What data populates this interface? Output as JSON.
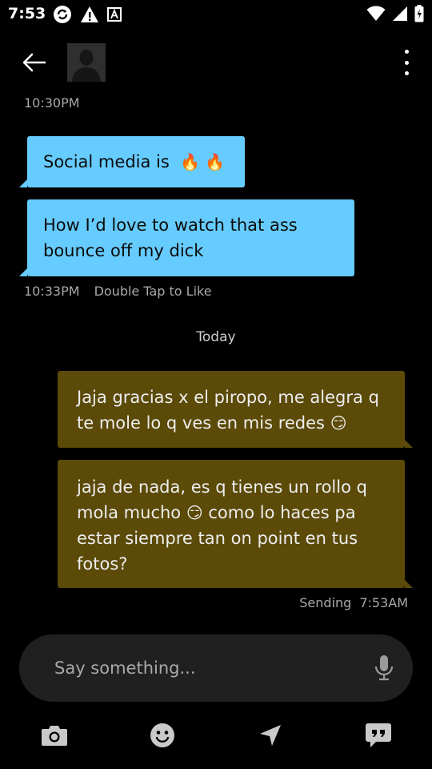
{
  "status_bar": {
    "time": "7:53"
  },
  "header": {
    "back_label": "Back",
    "menu_label": "More options"
  },
  "conversation": {
    "first_timestamp": "10:30PM",
    "incoming": [
      {
        "text": "Social media is",
        "emoji": "🔥 🔥"
      },
      {
        "text": "How I’d love to watch that ass bounce off my dick"
      }
    ],
    "incoming_meta": {
      "time": "10:33PM",
      "hint": "Double Tap to Like"
    },
    "day_divider": "Today",
    "outgoing": [
      {
        "text": "Jaja gracias x el piropo, me alegra q te mole lo q ves en mis redes",
        "emoji": "😏"
      },
      {
        "text_before": "jaja de nada, es q tienes un rollo q mola mucho",
        "emoji": "😏",
        "text_after": "como lo haces pa estar siempre tan on point en tus fotos?"
      }
    ],
    "outgoing_meta": {
      "status": "Sending",
      "time": "7:53AM"
    }
  },
  "composer": {
    "placeholder": "Say something..."
  },
  "toolbar": {
    "icons": [
      "camera-icon",
      "emoji-icon",
      "send-location-icon",
      "saved-phrases-icon"
    ]
  },
  "colors": {
    "incoming_bubble": "#66ccff",
    "outgoing_bubble": "#5b4a08",
    "background": "#000000",
    "input_background": "#202020"
  }
}
